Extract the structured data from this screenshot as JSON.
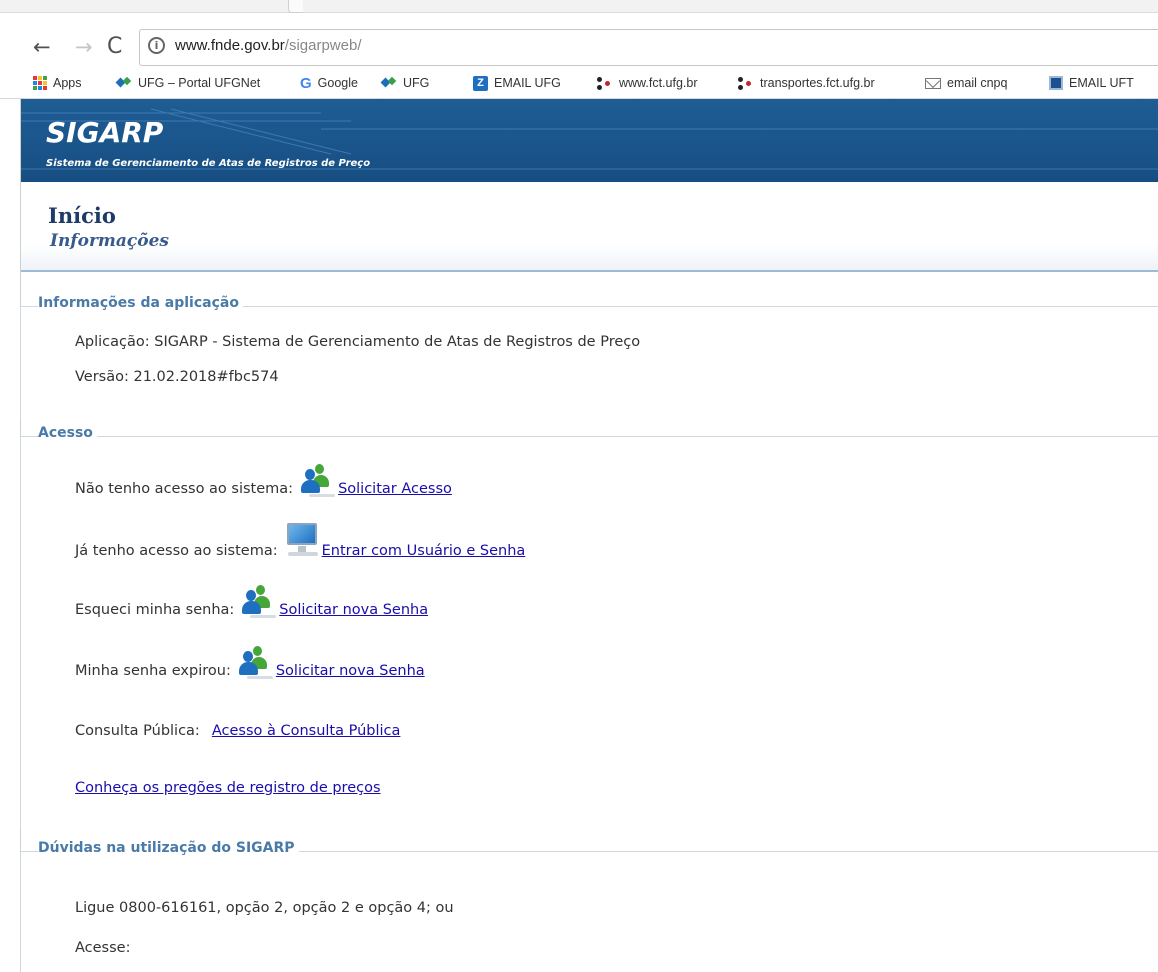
{
  "browser": {
    "url_host": "www.fnde.gov.br",
    "url_path": "/sigarpweb/",
    "nav": {
      "back": "←",
      "forward": "→",
      "reload": "C"
    },
    "bookmarks": [
      {
        "label": "Apps",
        "icon": "apps-grid-icon"
      },
      {
        "label": "UFG – Portal UFGNet",
        "icon": "ufg-icon"
      },
      {
        "label": "Google",
        "icon": "google-icon"
      },
      {
        "label": "UFG",
        "icon": "ufg-icon"
      },
      {
        "label": "EMAIL UFG",
        "icon": "z-icon"
      },
      {
        "label": "www.fct.ufg.br",
        "icon": "fct-icon"
      },
      {
        "label": "transportes.fct.ufg.br",
        "icon": "fct-icon"
      },
      {
        "label": "email cnpq",
        "icon": "mail-icon"
      },
      {
        "label": "EMAIL UFT",
        "icon": "uft-icon"
      }
    ]
  },
  "header": {
    "title": "SIGARP",
    "subtitle": "Sistema de Gerenciamento de Atas de Registros de Preço",
    "banner_color": "#1b5a92"
  },
  "breadcrumb": {
    "title": "Início",
    "subtitle": "Informações"
  },
  "info_section": {
    "legend": "Informações da aplicação",
    "application": "Aplicação: SIGARP - Sistema de Gerenciamento de Atas de Registros de Preço",
    "version": "Versão: 21.02.2018#fbc574"
  },
  "access_section": {
    "legend": "Acesso",
    "items": [
      {
        "label": "Não tenho acesso ao sistema:",
        "link": "Solicitar Acesso",
        "icon": "users-icon"
      },
      {
        "label": "Já tenho acesso ao sistema:",
        "link": "Entrar com Usuário e Senha",
        "icon": "monitor-icon"
      },
      {
        "label": "Esqueci minha senha:",
        "link": "Solicitar nova Senha",
        "icon": "users-icon"
      },
      {
        "label": "Minha senha expirou:",
        "link": "Solicitar nova Senha",
        "icon": "users-icon"
      },
      {
        "label": "Consulta Pública:",
        "link": "Acesso à Consulta Pública",
        "icon": ""
      }
    ],
    "pregoes_link": "Conheça os pregões de registro de preços"
  },
  "help_section": {
    "legend": "Dúvidas na utilização do SIGARP",
    "phone": "Ligue 0800-616161, opção 2, opção 2 e opção 4; ou",
    "access": "Acesse:"
  },
  "colors": {
    "link": "#1a0dab",
    "legend": "#4a7aa7",
    "title": "#1d3b66"
  }
}
